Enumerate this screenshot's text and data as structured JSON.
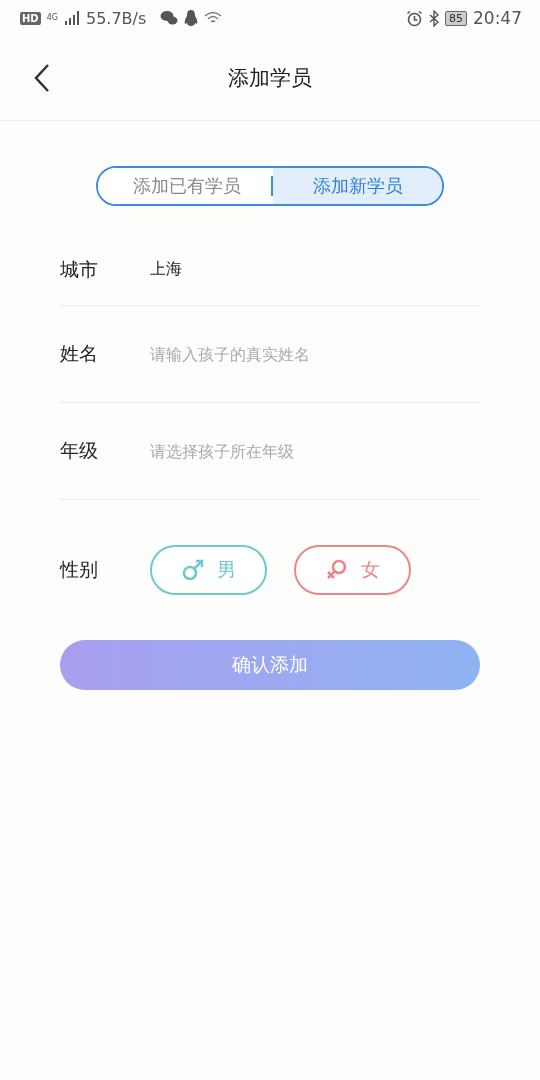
{
  "status_bar": {
    "hd": "HD",
    "network": "4G",
    "speed": "55.7B/s",
    "battery": "85",
    "time": "20:47"
  },
  "header": {
    "title": "添加学员"
  },
  "tabs": [
    {
      "label": "添加已有学员",
      "selected": false
    },
    {
      "label": "添加新学员",
      "selected": true
    }
  ],
  "fields": [
    {
      "label": "城市",
      "value": "上海"
    },
    {
      "label": "姓名",
      "placeholder": "请输入孩子的真实姓名"
    },
    {
      "label": "年级",
      "placeholder": "请选择孩子所在年级"
    }
  ],
  "gender": {
    "label": "性别",
    "options": [
      {
        "kind": "male",
        "label": "男",
        "color": "#6cc9cc",
        "selected": false
      },
      {
        "kind": "female",
        "label": "女",
        "color": "#ee8585",
        "selected": false
      }
    ]
  },
  "submit": {
    "label": "确认添加",
    "disabled": true
  }
}
